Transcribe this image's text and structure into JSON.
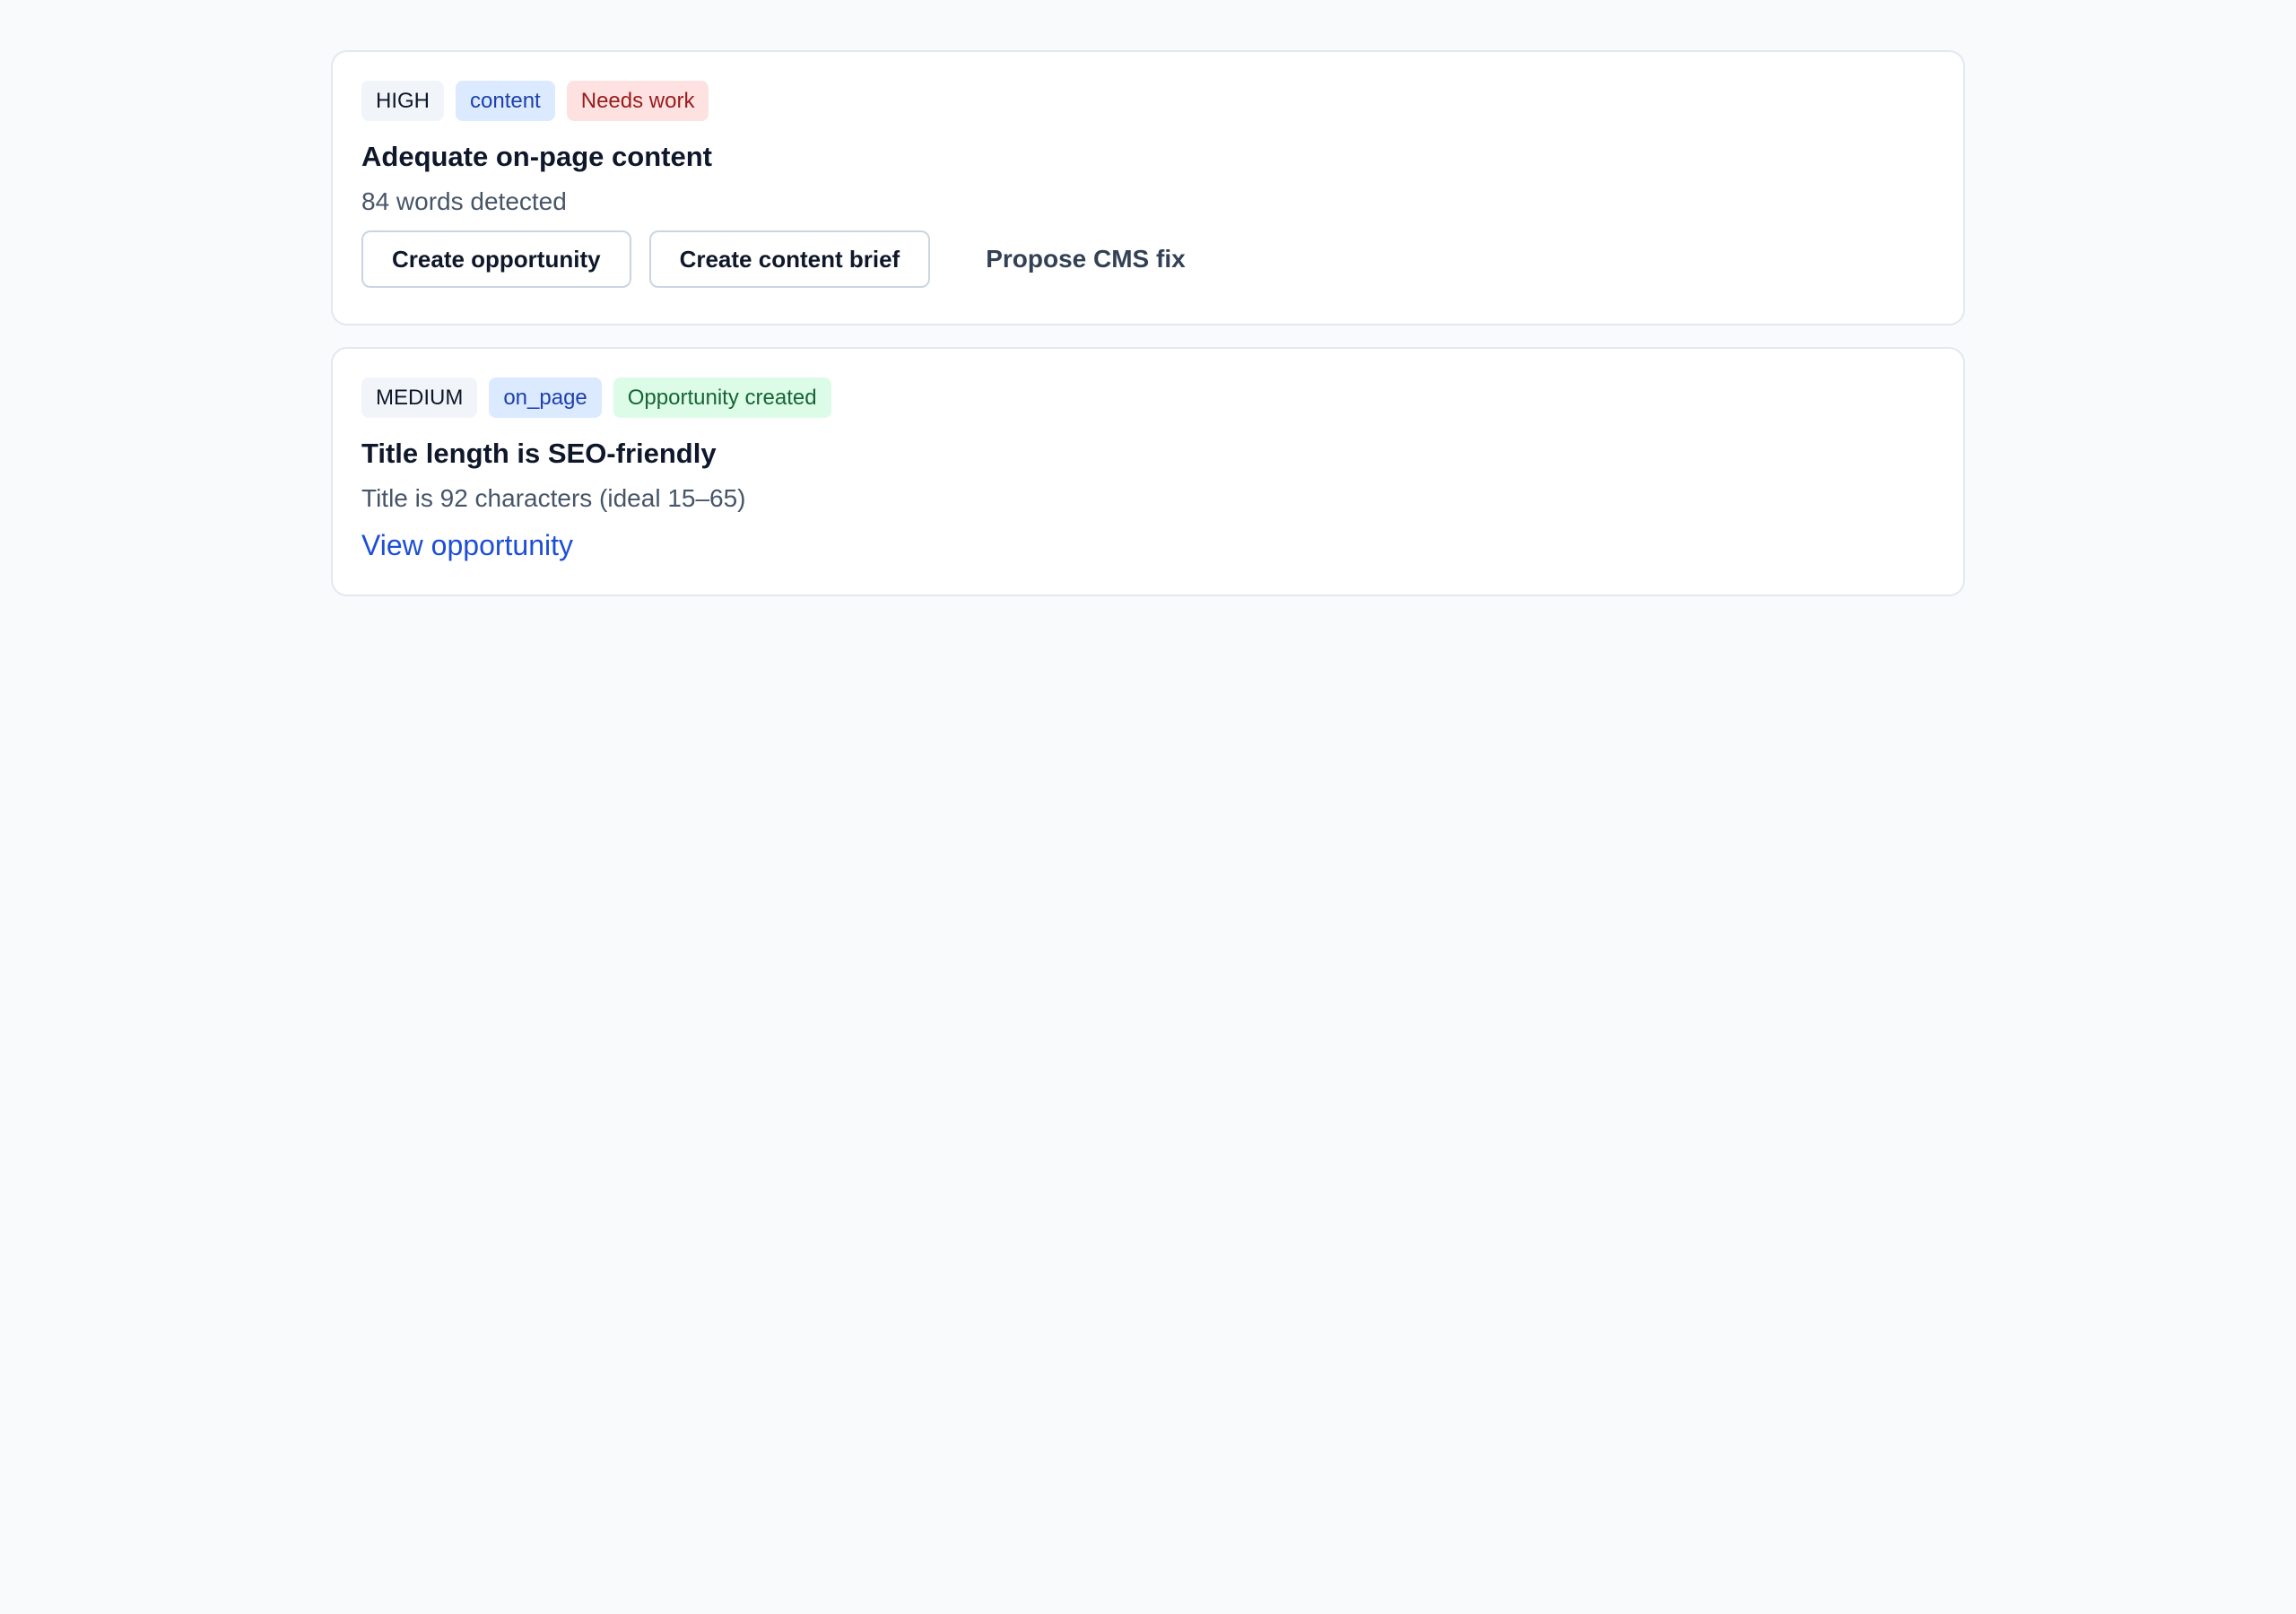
{
  "checks": [
    {
      "severity": "HIGH",
      "category": "content",
      "status": "Needs work",
      "title": "Adequate on-page content",
      "detail": "84 words detected",
      "actions": {
        "create_opportunity": "Create opportunity",
        "create_content_brief": "Create content brief",
        "propose_cms_fix": "Propose CMS fix"
      }
    },
    {
      "severity": "MEDIUM",
      "category": "on_page",
      "status": "Opportunity created",
      "title": "Title length is SEO-friendly",
      "detail": "Title is 92 characters (ideal 15–65)",
      "link": "View opportunity"
    }
  ],
  "colors": {
    "background": "#f8fafc",
    "card_border": "#e2e8f0",
    "link": "#1d4ed8",
    "status_needs_work_bg": "#fee2e2",
    "status_needs_work_text": "#991b1b",
    "status_created_bg": "#dcfce7",
    "status_created_text": "#166534",
    "category_bg": "#dbeafe",
    "category_text": "#1e40af"
  }
}
